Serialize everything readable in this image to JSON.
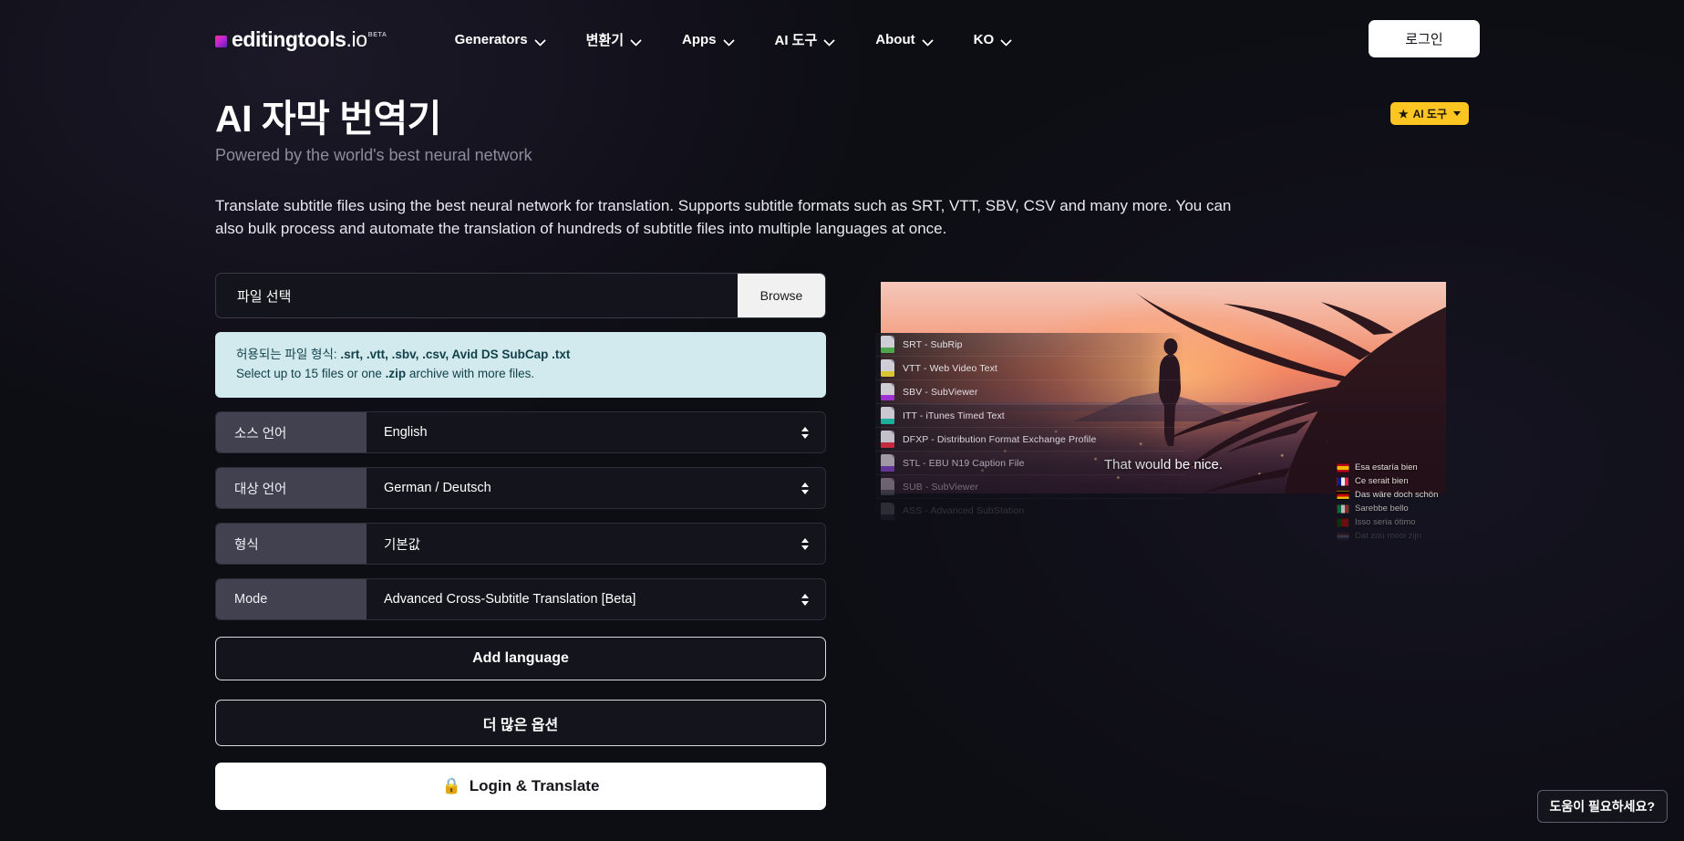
{
  "header": {
    "logo": {
      "name": "editingtools",
      "domain": ".io",
      "beta": "BETA"
    },
    "nav": [
      {
        "label": "Generators"
      },
      {
        "label": "변환기"
      },
      {
        "label": "Apps"
      },
      {
        "label": "AI 도구"
      },
      {
        "label": "About"
      },
      {
        "label": "KO"
      }
    ],
    "login_label": "로그인"
  },
  "hero_heading": {
    "title": "AI 자막 번역기",
    "subtitle": "Powered by the world's best neural network",
    "badge": {
      "star": "★",
      "label": "AI 도구"
    },
    "description": "Translate subtitle files using the best neural network for translation. Supports subtitle formats such as SRT, VTT, SBV, CSV and many more. You can also bulk process and automate the translation of hundreds of subtitle files into multiple languages at once."
  },
  "form": {
    "file_picker": {
      "label": "파일 선택",
      "browse_label": "Browse"
    },
    "info": {
      "line1_prefix": "허용되는 파일 형식: ",
      "line1_formats": ".srt, .vtt, .sbv, .csv, Avid DS SubCap .txt",
      "line2_prefix": "Select up to 15 files or one ",
      "line2_strong": ".zip",
      "line2_suffix": " archive with more files."
    },
    "rows": [
      {
        "label": "소스 언어",
        "value": "English"
      },
      {
        "label": "대상 언어",
        "value": "German / Deutsch"
      },
      {
        "label": "형식",
        "value": "기본값"
      },
      {
        "label": "Mode",
        "value": "Advanced Cross-Subtitle Translation [Beta]"
      }
    ],
    "add_language_label": "Add language",
    "more_options_label": "더 많은 옵션",
    "submit": {
      "icon": "🔒",
      "label": "Login & Translate"
    }
  },
  "hero_image": {
    "subtitle_text": "That would be nice.",
    "formats": [
      {
        "label": "SRT - SubRip",
        "color": "#4ca64c"
      },
      {
        "label": "VTT - Web Video Text",
        "color": "#d8c732"
      },
      {
        "label": "SBV - SubViewer",
        "color": "#9b2fd6"
      },
      {
        "label": "ITT - iTunes Timed Text",
        "color": "#16b5a0"
      },
      {
        "label": "DFXP - Distribution Format Exchange Profile",
        "color": "#cf2b3f"
      },
      {
        "label": "STL - EBU N19 Caption File",
        "color": "#7a3fc9"
      },
      {
        "label": "SUB - SubViewer",
        "color": "#5b6370"
      },
      {
        "label": "ASS - Advanced SubStation",
        "color": "#4a5160"
      }
    ],
    "translations": [
      {
        "flag": "es",
        "text": "Esa estaría bien"
      },
      {
        "flag": "fr",
        "text": "Ce serait bien"
      },
      {
        "flag": "de",
        "text": "Das wäre doch schön"
      },
      {
        "flag": "it",
        "text": "Sarebbe bello"
      },
      {
        "flag": "pt",
        "text": "Isso seria ótimo"
      },
      {
        "flag": "nl",
        "text": "Dat zou mooi zijn"
      }
    ]
  },
  "help_widget": {
    "label": "도움이 필요하세요?"
  }
}
